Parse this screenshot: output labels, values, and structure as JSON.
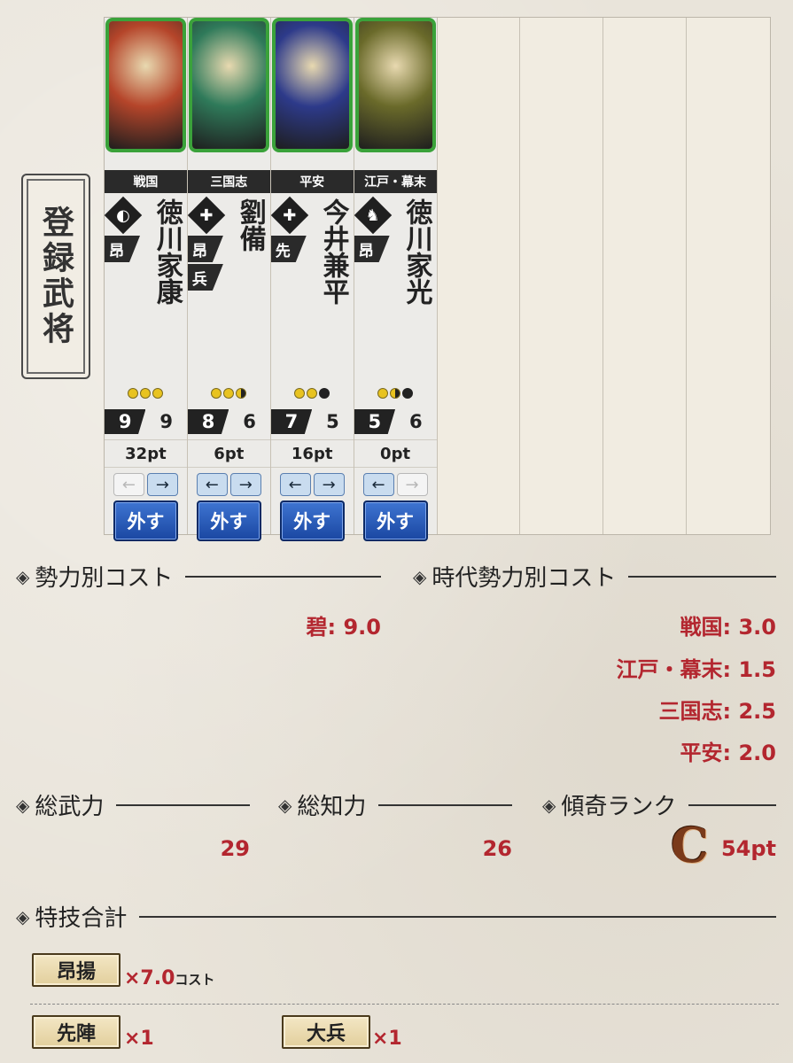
{
  "panel_label": "登録武将",
  "cards": [
    {
      "era": "戦国",
      "name": "徳川家康",
      "unit_icon": "bow-icon",
      "tags": [
        "昂"
      ],
      "coins": [
        "full",
        "full",
        "full"
      ],
      "stat_a": "9",
      "stat_b": "9",
      "points": "32pt",
      "left_enabled": false,
      "right_enabled": true,
      "remove_label": "外す",
      "art_color": "#b5452a"
    },
    {
      "era": "三国志",
      "name": "劉備",
      "unit_icon": "sword-icon",
      "tags": [
        "昂",
        "兵"
      ],
      "coins": [
        "full",
        "full",
        "half"
      ],
      "stat_a": "8",
      "stat_b": "6",
      "points": "6pt",
      "left_enabled": true,
      "right_enabled": true,
      "remove_label": "外す",
      "art_color": "#2f7a5a"
    },
    {
      "era": "平安",
      "name": "今井兼平",
      "unit_icon": "sword-icon",
      "tags": [
        "先"
      ],
      "coins": [
        "full",
        "full",
        "empty"
      ],
      "stat_a": "7",
      "stat_b": "5",
      "points": "16pt",
      "left_enabled": true,
      "right_enabled": true,
      "remove_label": "外す",
      "art_color": "#2d3a8a"
    },
    {
      "era": "江戸・幕末",
      "name": "徳川家光",
      "unit_icon": "horse-icon",
      "tags": [
        "昂"
      ],
      "coins": [
        "full",
        "half",
        "empty"
      ],
      "stat_a": "5",
      "stat_b": "6",
      "points": "0pt",
      "left_enabled": true,
      "right_enabled": false,
      "remove_label": "外す",
      "art_color": "#6a6a2a"
    }
  ],
  "empty_slots": 4,
  "arrows": {
    "left": "←",
    "right": "→"
  },
  "faction_cost": {
    "title": "勢力別コスト",
    "entries": [
      {
        "label": "碧: 9.0"
      }
    ]
  },
  "era_faction_cost": {
    "title": "時代勢力別コスト",
    "entries": [
      {
        "label": "戦国: 3.0"
      },
      {
        "label": "江戸・幕末: 1.5"
      },
      {
        "label": "三国志: 2.5"
      },
      {
        "label": "平安: 2.0"
      }
    ]
  },
  "total_power": {
    "title": "総武力",
    "value": "29"
  },
  "total_intel": {
    "title": "総知力",
    "value": "26"
  },
  "rank": {
    "title": "傾奇ランク",
    "letter": "C",
    "points": "54pt"
  },
  "skills": {
    "title": "特技合計",
    "items": [
      {
        "label": "昂揚",
        "mult": "×7.0",
        "unit": "コスト"
      },
      {
        "label": "先陣",
        "mult": "×1",
        "unit": ""
      },
      {
        "label": "大兵",
        "mult": "×1",
        "unit": ""
      }
    ]
  },
  "section_mark": "◈"
}
